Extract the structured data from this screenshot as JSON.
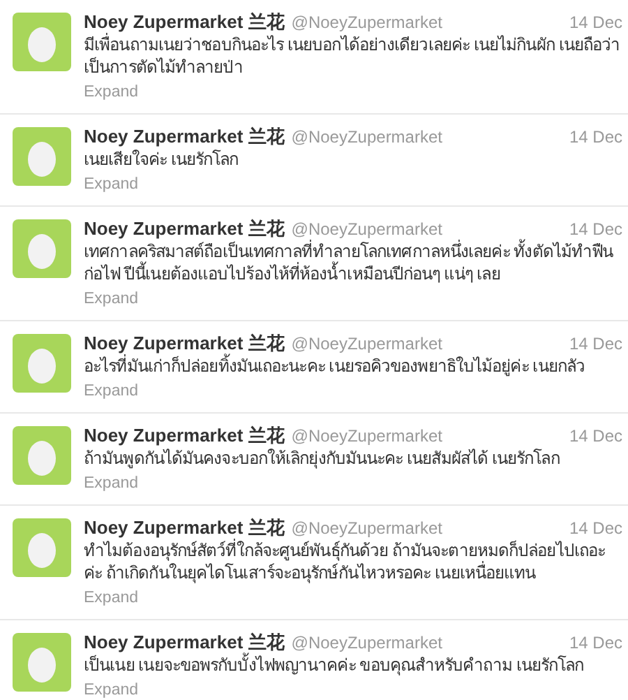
{
  "tweets": [
    {
      "name": "Noey Zupermarket 兰花",
      "handle": "@NoeyZupermarket",
      "time": "14 Dec",
      "text": "มีเพื่อนถามเนยว่าชอบกินอะไร เนยบอกได้อย่างเดียวเลยค่ะ เนยไม่กินผัก เนยถือว่าเป็นการตัดไม้ทำลายป่า",
      "expand": "Expand"
    },
    {
      "name": "Noey Zupermarket 兰花",
      "handle": "@NoeyZupermarket",
      "time": "14 Dec",
      "text": "เนยเสียใจค่ะ เนยรักโลก",
      "expand": "Expand"
    },
    {
      "name": "Noey Zupermarket 兰花",
      "handle": "@NoeyZupermarket",
      "time": "14 Dec",
      "text": "เทศกาลคริสมาสต์ถือเป็นเทศกาลที่ทำลายโลกเทศกาลหนึ่งเลยค่ะ ทั้งตัดไม้ทำฟืน ก่อไฟ ปีนี้เนยต้องแอบไปร้องไห้ที่ห้องน้ำเหมือนปีก่อนๆ แน่ๆ เลย",
      "expand": "Expand"
    },
    {
      "name": "Noey Zupermarket 兰花",
      "handle": "@NoeyZupermarket",
      "time": "14 Dec",
      "text": "อะไรที่มันเก่าก็ปล่อยทิ้งมันเถอะนะคะ เนยรอคิวของพยาธิใบไม้อยู่ค่ะ เนยกลัว",
      "expand": "Expand"
    },
    {
      "name": "Noey Zupermarket 兰花",
      "handle": "@NoeyZupermarket",
      "time": "14 Dec",
      "text": "ถ้ามันพูดกันได้มันคงจะบอกให้เลิกยุ่งกับมันนะคะ เนยสัมผัสได้ เนยรักโลก",
      "expand": "Expand"
    },
    {
      "name": "Noey Zupermarket 兰花",
      "handle": "@NoeyZupermarket",
      "time": "14 Dec",
      "text": "ทำไมต้องอนุรักษ์สัตว์ที่ใกล้จะศูนย์พันธุ์กันด้วย ถ้ามันจะตายหมดก็ปล่อยไปเถอะค่ะ ถ้าเกิดกันในยุคไดโนเสาร์จะอนุรักษ์กันไหวหรอคะ เนยเหนื่อยแทน",
      "expand": "Expand"
    },
    {
      "name": "Noey Zupermarket 兰花",
      "handle": "@NoeyZupermarket",
      "time": "14 Dec",
      "text": "เป็นเนย เนยจะขอพรกับบั้งไฟพญานาคค่ะ ขอบคุณสำหรับคำถาม เนยรักโลก",
      "expand": "Expand"
    }
  ]
}
